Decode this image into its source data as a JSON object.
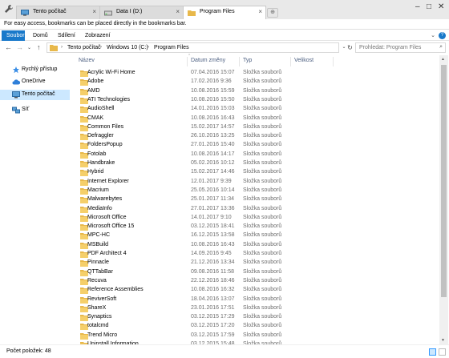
{
  "tabs": [
    {
      "label": "Tento počítač",
      "icon": "computer-icon"
    },
    {
      "label": "Data I (D:)",
      "icon": "drive-icon"
    },
    {
      "label": "Program Files",
      "icon": "folder-icon"
    }
  ],
  "bookmarks_notice": "For easy access, bookmarks can be placed directly in the bookmarks bar.",
  "ribbon": {
    "file": "Soubor",
    "home": "Domů",
    "share": "Sdílení",
    "view": "Zobrazení"
  },
  "address": {
    "segments": [
      "Tento počítač",
      "Windows 10 (C:)",
      "Program Files"
    ]
  },
  "search": {
    "placeholder": "Prohledat: Program Files"
  },
  "nav": [
    {
      "label": "Rychlý přístup",
      "icon": "star-icon"
    },
    {
      "label": "OneDrive",
      "icon": "cloud-icon"
    },
    {
      "label": "Tento počítač",
      "icon": "computer-icon"
    },
    {
      "label": "Síť",
      "icon": "network-icon"
    }
  ],
  "columns": {
    "name": "Název",
    "date": "Datum změny",
    "type": "Typ",
    "size": "Velikost"
  },
  "files": [
    {
      "name": "Acrylic Wi-Fi Home",
      "date": "07.04.2016 15:07",
      "type": "Složka souborů"
    },
    {
      "name": "Adobe",
      "date": "17.02.2016 9:36",
      "type": "Složka souborů"
    },
    {
      "name": "AMD",
      "date": "10.08.2016 15:59",
      "type": "Složka souborů"
    },
    {
      "name": "ATI Technologies",
      "date": "10.08.2016 15:50",
      "type": "Složka souborů"
    },
    {
      "name": "AudioShell",
      "date": "14.01.2016 15:03",
      "type": "Složka souborů"
    },
    {
      "name": "CMAK",
      "date": "10.08.2016 16:43",
      "type": "Složka souborů"
    },
    {
      "name": "Common Files",
      "date": "15.02.2017 14:57",
      "type": "Složka souborů"
    },
    {
      "name": "Defraggler",
      "date": "26.10.2016 13:25",
      "type": "Složka souborů"
    },
    {
      "name": "FoldersPopup",
      "date": "27.01.2016 15:40",
      "type": "Složka souborů"
    },
    {
      "name": "Fotolab",
      "date": "10.08.2016 14:17",
      "type": "Složka souborů"
    },
    {
      "name": "Handbrake",
      "date": "05.02.2016 10:12",
      "type": "Složka souborů"
    },
    {
      "name": "Hybrid",
      "date": "15.02.2017 14:46",
      "type": "Složka souborů"
    },
    {
      "name": "Internet Explorer",
      "date": "12.01.2017 9:39",
      "type": "Složka souborů"
    },
    {
      "name": "Macrium",
      "date": "25.05.2016 10:14",
      "type": "Složka souborů"
    },
    {
      "name": "Malwarebytes",
      "date": "25.01.2017 11:34",
      "type": "Složka souborů"
    },
    {
      "name": "MediaInfo",
      "date": "27.01.2017 13:36",
      "type": "Složka souborů"
    },
    {
      "name": "Microsoft Office",
      "date": "14.01.2017 9:10",
      "type": "Složka souborů"
    },
    {
      "name": "Microsoft Office 15",
      "date": "03.12.2015 18:41",
      "type": "Složka souborů"
    },
    {
      "name": "MPC-HC",
      "date": "16.12.2015 13:58",
      "type": "Složka souborů"
    },
    {
      "name": "MSBuild",
      "date": "10.08.2016 16:43",
      "type": "Složka souborů"
    },
    {
      "name": "PDF Architect 4",
      "date": "14.09.2016 9:45",
      "type": "Složka souborů"
    },
    {
      "name": "Pinnacle",
      "date": "21.12.2016 13:34",
      "type": "Složka souborů"
    },
    {
      "name": "QTTabBar",
      "date": "09.08.2016 11:58",
      "type": "Složka souborů"
    },
    {
      "name": "Recuva",
      "date": "22.12.2016 18:46",
      "type": "Složka souborů"
    },
    {
      "name": "Reference Assemblies",
      "date": "10.08.2016 16:32",
      "type": "Složka souborů"
    },
    {
      "name": "ReviverSoft",
      "date": "18.04.2016 13:07",
      "type": "Složka souborů"
    },
    {
      "name": "ShareX",
      "date": "23.01.2016 17:51",
      "type": "Složka souborů"
    },
    {
      "name": "Synaptics",
      "date": "03.12.2015 17:29",
      "type": "Složka souborů"
    },
    {
      "name": "totalcmd",
      "date": "03.12.2015 17:20",
      "type": "Složka souborů"
    },
    {
      "name": "Trend Micro",
      "date": "03.12.2015 17:59",
      "type": "Složka souborů"
    },
    {
      "name": "Uninstall Information",
      "date": "03.12.2015 15:48",
      "type": "Složka souborů"
    }
  ],
  "status": {
    "count_text": "Počet položek: 48"
  },
  "colors": {
    "accent": "#1979ca",
    "folder": "#e8b84a",
    "selection": "#cce8ff"
  }
}
